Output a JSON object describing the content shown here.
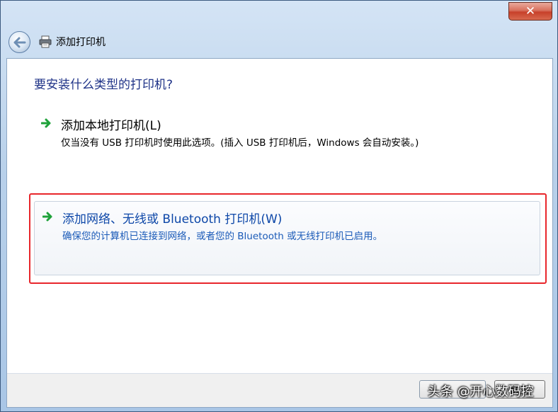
{
  "window": {
    "title": "添加打印机",
    "close_label": "✕"
  },
  "page": {
    "heading": "要安装什么类型的打印机?"
  },
  "options": [
    {
      "title": "添加本地打印机(L)",
      "description": "仅当没有 USB 打印机时使用此选项。(插入 USB 打印机后，Windows 会自动安装。)"
    },
    {
      "title": "添加网络、无线或 Bluetooth 打印机(W)",
      "description": "确保您的计算机已连接到网络，或者您的 Bluetooth 或无线打印机已启用。"
    }
  ],
  "footer": {
    "next_label": "",
    "cancel_label": "取消"
  },
  "watermark": "头条 @开心数码控",
  "colors": {
    "link_blue": "#0d47a8",
    "heading_blue": "#1e3287",
    "highlight_red": "#e8262b",
    "arrow_green": "#1fa23a"
  },
  "icons": {
    "back": "back-arrow-icon",
    "title": "printer-icon",
    "option": "green-arrow-icon"
  }
}
